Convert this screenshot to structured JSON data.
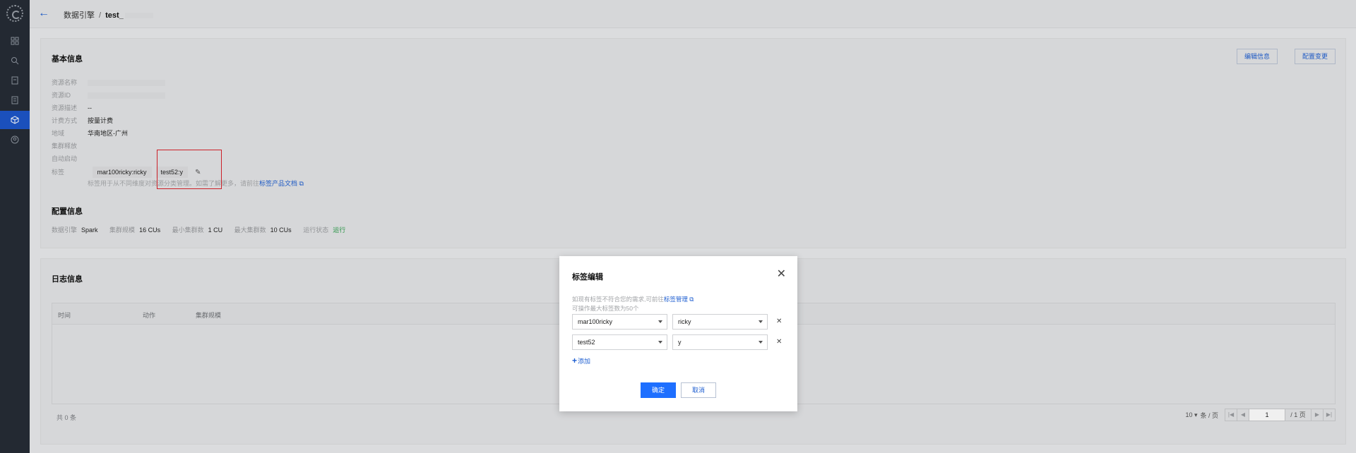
{
  "sidebar": {
    "logo_icon": "product-logo-icon",
    "items": [
      {
        "icon": "grid-icon",
        "active": false
      },
      {
        "icon": "search-icon",
        "active": false
      },
      {
        "icon": "document-icon",
        "active": false
      },
      {
        "icon": "list-document-icon",
        "active": false
      },
      {
        "icon": "engine-cube-icon",
        "active": true
      },
      {
        "icon": "user-circle-icon",
        "active": false
      }
    ]
  },
  "header": {
    "breadcrumb_parent": "数据引擎",
    "breadcrumb_sep": "/",
    "breadcrumb_current": "test_"
  },
  "basic": {
    "title": "基本信息",
    "edit_btn": "编辑信息",
    "config_btn": "配置变更",
    "rows": {
      "name_label": "资源名称",
      "id_label": "资源ID",
      "desc_label": "资源描述",
      "desc_value": "--",
      "billing_label": "计费方式",
      "billing_value": "按量计费",
      "region_label": "地域",
      "region_value": "华南地区-广州",
      "cluster_label": "集群释放",
      "autostart_label": "自动启动",
      "tags_label": "标签"
    },
    "tags": [
      "mar100ricky:ricky",
      "test52:y"
    ],
    "tag_hint_prefix": "标签用于从不同维度对资源分类管理。如需了解更多，请前往",
    "tag_hint_link": "标签产品文档"
  },
  "config": {
    "title": "配置信息",
    "engine_label": "数据引擎",
    "engine_value": "Spark",
    "scale_label": "集群规模",
    "scale_value": "16 CUs",
    "min_label": "最小集群数",
    "min_value": "1 CU",
    "max_label": "最大集群数",
    "max_value": "10 CUs",
    "status_label": "运行状态",
    "status_value": "运行"
  },
  "log": {
    "title": "日志信息",
    "columns": [
      "时间",
      "动作",
      "集群规模"
    ],
    "total": "共 0 条",
    "page_size": "10",
    "page_size_suffix": "条 / 页",
    "page": "1",
    "page_total": "/ 1 页"
  },
  "dialog": {
    "title": "标签编辑",
    "tip_line1_prefix": "如现有标签不符合您的需求,可前往",
    "tip_line1_link": "标签管理",
    "tip_line2": "可操作最大标签数为50个",
    "pairs": [
      {
        "key": "mar100ricky",
        "value": "ricky"
      },
      {
        "key": "test52",
        "value": "y"
      }
    ],
    "add_label": "添加",
    "ok_label": "确定",
    "cancel_label": "取消"
  },
  "colors": {
    "accent": "#1e6fff",
    "sidebar_bg": "#262c36",
    "highlight_border": "#d9232b",
    "status_ok": "#2a9d4a"
  }
}
